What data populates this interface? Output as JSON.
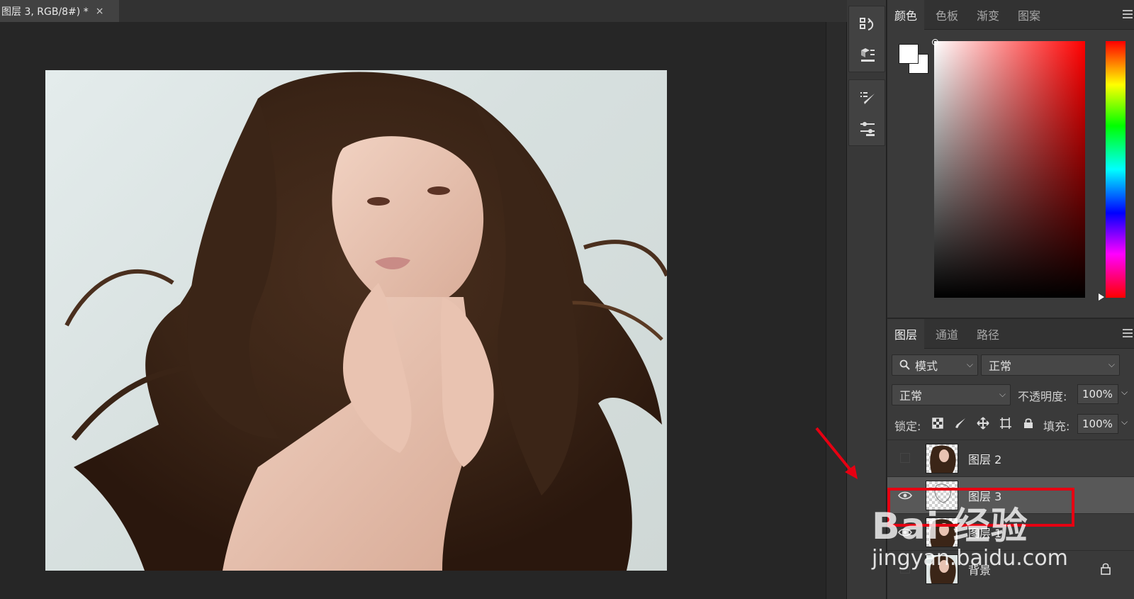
{
  "document_tab": {
    "title": "图层 3, RGB/8#) *",
    "close_glyph": "×"
  },
  "color_panel": {
    "tabs": [
      "颜色",
      "色板",
      "渐变",
      "图案"
    ],
    "active_tab": 0,
    "foreground_color": "#ffffff",
    "background_color": "#ffffff",
    "hue_color": "#ff0000"
  },
  "layers_panel": {
    "tabs": [
      "图层",
      "通道",
      "路径"
    ],
    "active_tab": 0,
    "filter_kind": "模式",
    "filter_value": "正常",
    "blend_mode": "正常",
    "opacity_label": "不透明度:",
    "opacity_value": "100%",
    "lock_label": "锁定:",
    "fill_label": "填充:",
    "fill_value": "100%",
    "layers": [
      {
        "name": "图层 2",
        "visible": false,
        "selected": false,
        "locked": false
      },
      {
        "name": "图层 3",
        "visible": true,
        "selected": true,
        "locked": false
      },
      {
        "name": "图层 1",
        "visible": true,
        "selected": false,
        "locked": false
      },
      {
        "name": "背景",
        "visible": false,
        "selected": false,
        "locked": true
      }
    ]
  },
  "toolstrip": {
    "icons": [
      "history-icon",
      "3d-material-icon",
      "brush-settings-icon",
      "adjustments-icon"
    ]
  },
  "annotation": {
    "highlight_color": "#e60012",
    "arrow_color": "#e60012"
  },
  "watermark": {
    "logo": "Bai 经验",
    "url": "jingyan.baidu.com"
  }
}
